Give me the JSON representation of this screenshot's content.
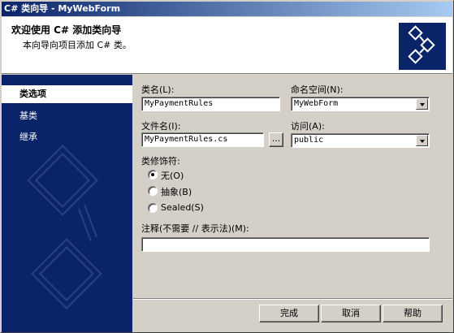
{
  "window": {
    "title": "C# 类向导 - MyWebForm"
  },
  "header": {
    "title": "欢迎使用 C# 添加类向导",
    "subtitle": "本向导向项目添加 C# 类。",
    "logo_icon": "wizard-diagram-icon"
  },
  "sidebar": {
    "items": [
      {
        "label": "类选项",
        "selected": true
      },
      {
        "label": "基类",
        "selected": false
      },
      {
        "label": "继承",
        "selected": false
      }
    ]
  },
  "form": {
    "class_name": {
      "label": "类名(L):",
      "value": "MyPaymentRules"
    },
    "namespace": {
      "label": "命名空间(N):",
      "value": "MyWebForm"
    },
    "file_name": {
      "label": "文件名(I):",
      "value": "MyPaymentRules.cs",
      "browse_label": "..."
    },
    "access": {
      "label": "访问(A):",
      "value": "public"
    },
    "modifiers": {
      "label": "类修饰符:",
      "options": [
        {
          "label": "无(O)",
          "checked": true
        },
        {
          "label": "抽象(B)",
          "checked": false
        },
        {
          "label": "Sealed(S)",
          "checked": false
        }
      ]
    },
    "comment": {
      "label": "注释(不需要 // 表示法)(M):",
      "value": ""
    }
  },
  "buttons": {
    "finish": "完成",
    "cancel": "取消",
    "help": "帮助"
  }
}
